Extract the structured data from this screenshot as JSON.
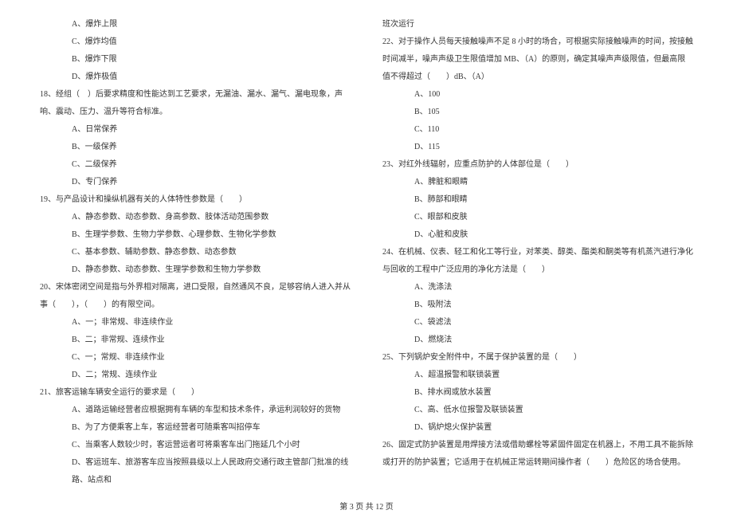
{
  "left_column": {
    "q17_options": {
      "a": "A、爆炸上限",
      "c": "C、爆炸均值",
      "b": "B、爆炸下限",
      "d": "D、爆炸极值"
    },
    "q18": {
      "text": "18、经组（　）后要求精度和性能达到工艺要求，无漏油、漏水、漏气、漏电现象，声响、震动、压力、温升等符合标准。",
      "a": "A、日常保养",
      "b": "B、一级保养",
      "c": "C、二级保养",
      "d": "D、专门保养"
    },
    "q19": {
      "text": "19、与产品设计和操纵机器有关的人体特性参数是（　　）",
      "a": "A、静态参数、动态参数、身高参数、肢体活动范围参数",
      "b": "B、生理学参数、生物力学参数、心理参数、生物化学参数",
      "c": "C、基本参数、辅助参数、静态参数、动态参数",
      "d": "D、静态参数、动态参数、生理学参数和生物力学参数"
    },
    "q20": {
      "text": "20、宋体密闭空间是指与外界相对隔离，进口受限，自然通风不良，足够容纳人进入并从事（　　），（　　）的有限空间。",
      "a": "A、一；非常规、非连续作业",
      "b": "B、二；非常规、连续作业",
      "c": "C、一；常规、非连续作业",
      "d": "D、二；常规、连续作业"
    },
    "q21": {
      "text": "21、旅客运输车辆安全运行的要求是（　　）",
      "a": "A、道路运输经营者应根据拥有车辆的车型和技术条件，承运利润较好的货物",
      "b": "B、为了方便乘客上车，客运经营者可随乘客叫招停车",
      "c": "C、当乘客人数较少时，客运营运者可将乘客车出门拖延几个小时",
      "d": "D、客运班车、旅游客车应当按照县级以上人民政府交通行政主管部门批准的线路、站点和"
    }
  },
  "right_column": {
    "q21_cont": "班次运行",
    "q22": {
      "text": "22、对于操作人员每天接触噪声不足 8 小时的场合，可根据实际接触噪声的时间，按接触时间减半，噪声声级卫生限值增加 MB、（A）的原则，确定其噪声声级限值，但最高限值不得超过（　　）dB、（A）",
      "a": "A、100",
      "b": "B、105",
      "c": "C、110",
      "d": "D、115"
    },
    "q23": {
      "text": "23、对红外线辐射，应重点防护的人体部位是（　　）",
      "a": "A、脾脏和眼睛",
      "b": "B、肺部和眼睛",
      "c": "C、眼部和皮肤",
      "d": "D、心脏和皮肤"
    },
    "q24": {
      "text": "24、在机械、仪表、轻工和化工等行业，对苯类、醇类、酯类和酮类等有机蒸汽进行净化与回收的工程中广泛应用的净化方法是（　　）",
      "a": "A、洗涤法",
      "b": "B、吸附法",
      "c": "C、袋滤法",
      "d": "D、燃烧法"
    },
    "q25": {
      "text": "25、下列锅炉安全附件中，不属于保护装置的是（　　）",
      "a": "A、超温报警和联锁装置",
      "b": "B、排水阀或放水装置",
      "c": "C、高、低水位报警及联锁装置",
      "d": "D、锅炉熄火保护装置"
    },
    "q26": {
      "text": "26、固定式防护装置是用焊接方法或借助螺栓等紧固件固定在机器上，不用工具不能拆除或打开的防护装置；它适用于在机械正常运转期间操作者（　　）危险区的场合使用。"
    }
  },
  "footer": "第 3 页 共 12 页"
}
